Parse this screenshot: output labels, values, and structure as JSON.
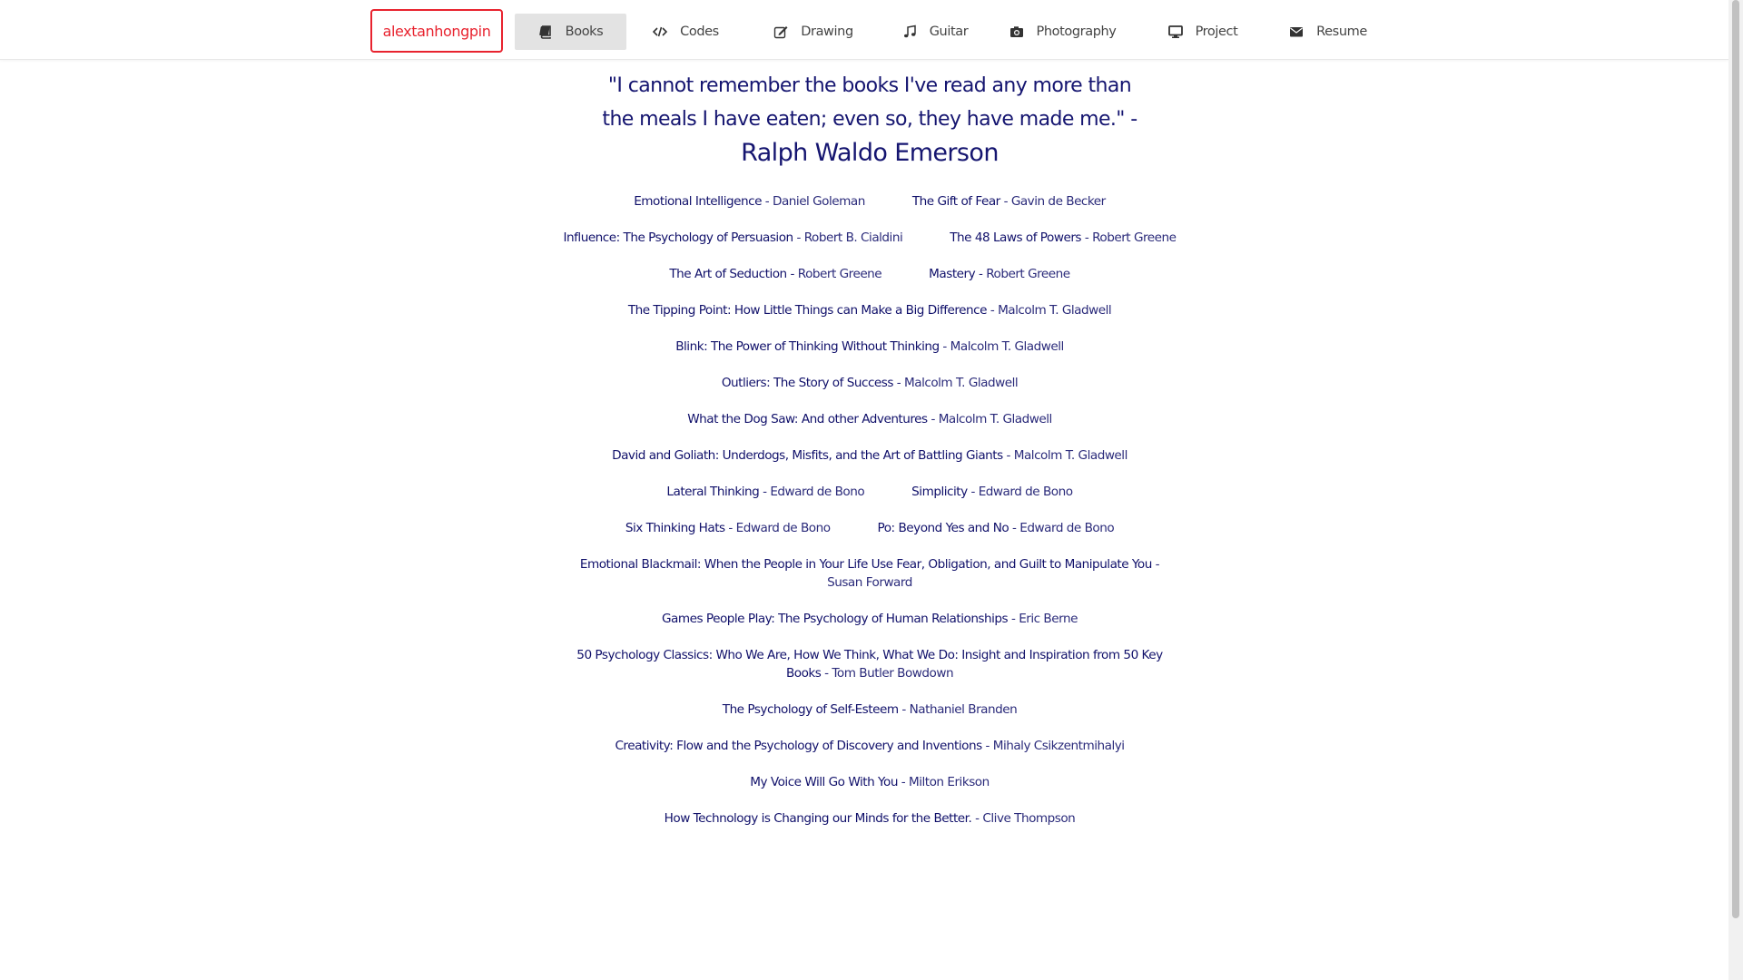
{
  "brand": "alextanhongpin",
  "nav": [
    {
      "label": "Books",
      "icon": "book-icon"
    },
    {
      "label": "Codes",
      "icon": "code-icon"
    },
    {
      "label": "Drawing",
      "icon": "edit-icon"
    },
    {
      "label": "Guitar",
      "icon": "music-icon"
    },
    {
      "label": "Photography",
      "icon": "camera-icon"
    },
    {
      "label": "Project",
      "icon": "desktop-icon"
    },
    {
      "label": "Resume",
      "icon": "envelope-icon"
    }
  ],
  "quote": {
    "text": "\"I cannot remember the books I've read any more than the meals I have eaten; even so, they have made me.\" -",
    "author": "Ralph Waldo Emerson"
  },
  "separator": " - ",
  "books": [
    {
      "title": "Emotional Intelligence",
      "author": "Daniel Goleman"
    },
    {
      "title": "The Gift of Fear",
      "author": "Gavin de Becker"
    },
    {
      "title": "Influence: The Psychology of Persuasion",
      "author": "Robert B. Cialdini"
    },
    {
      "title": "The 48 Laws of Powers",
      "author": "Robert Greene"
    },
    {
      "title": "The Art of Seduction",
      "author": "Robert Greene"
    },
    {
      "title": "Mastery",
      "author": "Robert Greene"
    },
    {
      "title": "The Tipping Point: How Little Things can Make a Big Difference",
      "author": "Malcolm T. Gladwell"
    },
    {
      "title": "Blink: The Power of Thinking Without Thinking",
      "author": "Malcolm T. Gladwell"
    },
    {
      "title": "Outliers: The Story of Success",
      "author": "Malcolm T. Gladwell"
    },
    {
      "title": "What the Dog Saw: And other Adventures",
      "author": "Malcolm T. Gladwell"
    },
    {
      "title": "David and Goliath: Underdogs, Misfits, and the Art of Battling Giants",
      "author": "Malcolm T. Gladwell"
    },
    {
      "title": "Lateral Thinking",
      "author": "Edward de Bono"
    },
    {
      "title": "Simplicity",
      "author": "Edward de Bono"
    },
    {
      "title": "Six Thinking Hats",
      "author": "Edward de Bono"
    },
    {
      "title": "Po: Beyond Yes and No",
      "author": "Edward de Bono"
    },
    {
      "title": "Emotional Blackmail: When the People in Your Life Use Fear, Obligation, and Guilt to Manipulate You",
      "author": "Susan Forward"
    },
    {
      "title": "Games People Play: The Psychology of Human Relationships",
      "author": "Eric Berne"
    },
    {
      "title": "50 Psychology Classics: Who We Are, How We Think, What We Do: Insight and Inspiration from 50 Key Books",
      "author": "Tom Butler Bowdown"
    },
    {
      "title": "The Psychology of Self-Esteem",
      "author": "Nathaniel Branden"
    },
    {
      "title": "Creativity: Flow and the Psychology of Discovery and Inventions",
      "author": "Mihaly Csikzentmihalyi"
    },
    {
      "title": "My Voice Will Go With You",
      "author": "Milton Erikson"
    },
    {
      "title": "How Technology is Changing our Minds for the Better.",
      "author": "Clive Thompson"
    }
  ],
  "colors": {
    "brand": "#e8232f",
    "text": "#14146e",
    "active_tab": "#e3e3e3"
  }
}
